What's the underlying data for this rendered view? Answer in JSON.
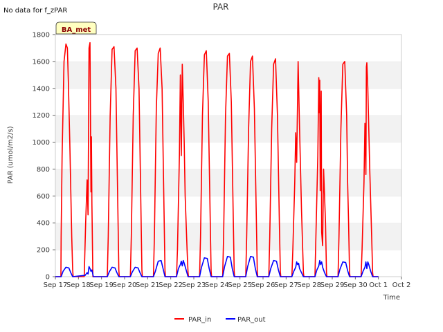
{
  "no_data_note": "No data for f_zPAR",
  "site_badge": "BA_met",
  "chart_data": {
    "type": "line",
    "title": "PAR",
    "xlabel": "Time",
    "ylabel": "PAR (umol/m2/s)",
    "xlim": [
      "2023-09-17",
      "2023-10-02"
    ],
    "ylim": [
      0,
      1800
    ],
    "x_ticks": [
      "Sep 17",
      "Sep 18",
      "Sep 19",
      "Sep 20",
      "Sep 21",
      "Sep 22",
      "Sep 23",
      "Sep 24",
      "Sep 25",
      "Sep 26",
      "Sep 27",
      "Sep 28",
      "Sep 29",
      "Sep 30",
      "Oct 1",
      "Oct 2"
    ],
    "y_ticks": [
      0,
      200,
      400,
      600,
      800,
      1000,
      1200,
      1400,
      1600,
      1800
    ],
    "grid": "horizontal bands",
    "legend_position": "bottom",
    "series": [
      {
        "name": "PAR_in",
        "color": "#ff0000",
        "x": [
          "2023-09-17 00:00",
          "2023-09-17 05:45",
          "2023-09-17 06:00",
          "2023-09-17 07:00",
          "2023-09-17 09:00",
          "2023-09-17 11:00",
          "2023-09-17 12:30",
          "2023-09-17 13:30",
          "2023-09-17 15:00",
          "2023-09-17 17:00",
          "2023-09-17 18:00",
          "2023-09-17 18:30",
          "2023-09-18 06:00",
          "2023-09-18 07:30",
          "2023-09-18 09:00",
          "2023-09-18 10:00",
          "2023-09-18 11:00",
          "2023-09-18 12:00",
          "2023-09-18 13:00",
          "2023-09-18 13:30",
          "2023-09-18 14:00",
          "2023-09-18 15:00",
          "2023-09-18 16:00",
          "2023-09-18 18:30",
          "2023-09-19 06:00",
          "2023-09-19 07:00",
          "2023-09-19 09:00",
          "2023-09-19 11:00",
          "2023-09-19 13:00",
          "2023-09-19 15:00",
          "2023-09-19 17:00",
          "2023-09-19 18:00",
          "2023-09-19 18:30",
          "2023-09-20 06:00",
          "2023-09-20 07:00",
          "2023-09-20 09:00",
          "2023-09-20 11:00",
          "2023-09-20 13:00",
          "2023-09-20 15:00",
          "2023-09-20 17:00",
          "2023-09-20 18:00",
          "2023-09-20 18:30",
          "2023-09-21 06:00",
          "2023-09-21 07:00",
          "2023-09-21 09:00",
          "2023-09-21 11:00",
          "2023-09-21 13:00",
          "2023-09-21 15:00",
          "2023-09-21 17:00",
          "2023-09-21 18:00",
          "2023-09-21 18:30",
          "2023-09-22 06:00",
          "2023-09-22 07:00",
          "2023-09-22 09:00",
          "2023-09-22 10:00",
          "2023-09-22 11:00",
          "2023-09-22 12:00",
          "2023-09-22 13:00",
          "2023-09-22 14:00",
          "2023-09-22 15:00",
          "2023-09-22 17:00",
          "2023-09-22 18:00",
          "2023-09-22 18:30",
          "2023-09-23 06:00",
          "2023-09-23 07:00",
          "2023-09-23 09:00",
          "2023-09-23 11:00",
          "2023-09-23 13:00",
          "2023-09-23 15:00",
          "2023-09-23 17:00",
          "2023-09-23 18:00",
          "2023-09-23 18:30",
          "2023-09-24 06:00",
          "2023-09-24 07:00",
          "2023-09-24 09:00",
          "2023-09-24 11:00",
          "2023-09-24 13:00",
          "2023-09-24 15:00",
          "2023-09-24 17:00",
          "2023-09-24 18:00",
          "2023-09-24 18:30",
          "2023-09-25 06:00",
          "2023-09-25 07:00",
          "2023-09-25 09:00",
          "2023-09-25 11:00",
          "2023-09-25 12:00",
          "2023-09-25 13:00",
          "2023-09-25 15:00",
          "2023-09-25 17:00",
          "2023-09-25 18:00",
          "2023-09-25 18:30",
          "2023-09-26 06:00",
          "2023-09-26 07:00",
          "2023-09-26 09:00",
          "2023-09-26 11:00",
          "2023-09-26 13:00",
          "2023-09-26 15:00",
          "2023-09-26 17:00",
          "2023-09-26 18:00",
          "2023-09-26 18:30",
          "2023-09-27 06:00",
          "2023-09-27 07:00",
          "2023-09-27 09:00",
          "2023-09-27 10:00",
          "2023-09-27 11:00",
          "2023-09-27 12:30",
          "2023-09-27 14:00",
          "2023-09-27 16:00",
          "2023-09-27 18:00",
          "2023-09-27 18:30",
          "2023-09-28 06:00",
          "2023-09-28 07:00",
          "2023-09-28 09:00",
          "2023-09-28 10:00",
          "2023-09-28 10:30",
          "2023-09-28 11:00",
          "2023-09-28 11:30",
          "2023-09-28 12:00",
          "2023-09-28 12:30",
          "2023-09-28 13:00",
          "2023-09-28 14:00",
          "2023-09-28 15:00",
          "2023-09-28 17:00",
          "2023-09-28 18:00",
          "2023-09-28 18:30",
          "2023-09-29 06:00",
          "2023-09-29 07:00",
          "2023-09-29 09:00",
          "2023-09-29 11:00",
          "2023-09-29 13:00",
          "2023-09-29 15:00",
          "2023-09-29 16:00",
          "2023-09-29 17:00",
          "2023-09-29 18:00",
          "2023-09-29 18:30",
          "2023-09-30 06:00",
          "2023-09-30 07:00",
          "2023-09-30 09:00",
          "2023-09-30 10:00",
          "2023-09-30 11:00",
          "2023-09-30 11:30",
          "2023-09-30 12:00",
          "2023-09-30 13:00",
          "2023-09-30 15:00",
          "2023-09-30 17:00",
          "2023-09-30 18:00",
          "2023-09-30 18:30",
          "2023-10-01 00:00"
        ],
        "y": [
          0,
          0,
          300,
          900,
          1600,
          1730,
          1700,
          1450,
          1000,
          300,
          50,
          0,
          0,
          400,
          720,
          460,
          1700,
          1740,
          630,
          1040,
          540,
          0,
          0,
          0,
          0,
          300,
          1200,
          1690,
          1710,
          1400,
          500,
          50,
          0,
          0,
          300,
          1200,
          1680,
          1700,
          1400,
          500,
          50,
          0,
          0,
          300,
          1250,
          1660,
          1700,
          1400,
          500,
          50,
          0,
          0,
          200,
          900,
          1500,
          900,
          1580,
          1300,
          1000,
          600,
          200,
          30,
          0,
          0,
          300,
          1200,
          1650,
          1680,
          1300,
          450,
          40,
          0,
          0,
          300,
          1200,
          1640,
          1660,
          1300,
          450,
          40,
          0,
          0,
          300,
          1100,
          1600,
          1620,
          1640,
          1250,
          450,
          40,
          0,
          0,
          300,
          1100,
          1580,
          1620,
          1200,
          400,
          40,
          0,
          0,
          200,
          700,
          1070,
          850,
          1600,
          1100,
          500,
          30,
          0,
          0,
          300,
          900,
          1480,
          1220,
          1460,
          640,
          1140,
          1380,
          330,
          230,
          800,
          400,
          30,
          0,
          0,
          300,
          1100,
          1580,
          1600,
          1200,
          700,
          400,
          30,
          0,
          0,
          200,
          700,
          1140,
          760,
          1560,
          1590,
          1400,
          800,
          300,
          30,
          0,
          0
        ]
      },
      {
        "name": "PAR_out",
        "color": "#0000ff",
        "x": [
          "2023-09-17 00:00",
          "2023-09-17 06:00",
          "2023-09-17 08:00",
          "2023-09-17 11:00",
          "2023-09-17 14:00",
          "2023-09-17 16:00",
          "2023-09-17 18:00",
          "2023-09-18 07:00",
          "2023-09-18 09:00",
          "2023-09-18 10:00",
          "2023-09-18 11:00",
          "2023-09-18 12:00",
          "2023-09-18 13:00",
          "2023-09-18 14:00",
          "2023-09-18 15:30",
          "2023-09-19 06:00",
          "2023-09-19 08:00",
          "2023-09-19 11:00",
          "2023-09-19 14:00",
          "2023-09-19 16:00",
          "2023-09-19 18:00",
          "2023-09-20 06:00",
          "2023-09-20 08:00",
          "2023-09-20 11:00",
          "2023-09-20 14:00",
          "2023-09-20 16:00",
          "2023-09-20 18:00",
          "2023-09-21 06:00",
          "2023-09-21 08:00",
          "2023-09-21 11:00",
          "2023-09-21 14:00",
          "2023-09-21 16:00",
          "2023-09-21 18:00",
          "2023-09-22 06:00",
          "2023-09-22 08:00",
          "2023-09-22 10:00",
          "2023-09-22 11:00",
          "2023-09-22 12:00",
          "2023-09-22 13:00",
          "2023-09-22 14:00",
          "2023-09-22 16:00",
          "2023-09-22 18:00",
          "2023-09-23 06:00",
          "2023-09-23 08:00",
          "2023-09-23 11:00",
          "2023-09-23 14:00",
          "2023-09-23 16:00",
          "2023-09-23 18:00",
          "2023-09-24 06:00",
          "2023-09-24 08:00",
          "2023-09-24 11:00",
          "2023-09-24 14:00",
          "2023-09-24 16:00",
          "2023-09-24 18:00",
          "2023-09-25 06:00",
          "2023-09-25 08:00",
          "2023-09-25 11:00",
          "2023-09-25 14:00",
          "2023-09-25 16:00",
          "2023-09-25 18:00",
          "2023-09-26 06:00",
          "2023-09-26 08:00",
          "2023-09-26 11:00",
          "2023-09-26 14:00",
          "2023-09-26 16:00",
          "2023-09-26 18:00",
          "2023-09-27 06:00",
          "2023-09-27 08:00",
          "2023-09-27 10:00",
          "2023-09-27 11:00",
          "2023-09-27 12:00",
          "2023-09-27 13:00",
          "2023-09-27 14:00",
          "2023-09-27 16:00",
          "2023-09-27 18:00",
          "2023-09-28 06:00",
          "2023-09-28 08:00",
          "2023-09-28 10:00",
          "2023-09-28 11:00",
          "2023-09-28 12:00",
          "2023-09-28 13:00",
          "2023-09-28 14:00",
          "2023-09-28 16:00",
          "2023-09-28 18:00",
          "2023-09-29 06:00",
          "2023-09-29 08:00",
          "2023-09-29 11:00",
          "2023-09-29 14:00",
          "2023-09-29 16:00",
          "2023-09-29 18:00",
          "2023-09-30 06:00",
          "2023-09-30 08:00",
          "2023-09-30 10:00",
          "2023-09-30 11:00",
          "2023-09-30 12:00",
          "2023-09-30 13:00",
          "2023-09-30 14:00",
          "2023-09-30 16:00",
          "2023-09-30 18:00",
          "2023-10-01 00:00"
        ],
        "y": [
          0,
          0,
          40,
          70,
          65,
          30,
          0,
          10,
          30,
          20,
          75,
          60,
          40,
          50,
          0,
          0,
          35,
          70,
          65,
          30,
          0,
          0,
          35,
          70,
          65,
          30,
          0,
          0,
          40,
          115,
          120,
          60,
          0,
          0,
          60,
          90,
          115,
          80,
          120,
          100,
          50,
          0,
          0,
          70,
          140,
          135,
          60,
          0,
          0,
          75,
          150,
          145,
          60,
          0,
          0,
          75,
          150,
          145,
          60,
          0,
          0,
          60,
          120,
          115,
          50,
          0,
          0,
          40,
          70,
          110,
          90,
          100,
          60,
          30,
          0,
          0,
          50,
          80,
          120,
          90,
          110,
          70,
          30,
          0,
          0,
          55,
          110,
          105,
          45,
          0,
          0,
          40,
          70,
          110,
          60,
          110,
          90,
          40,
          0,
          0
        ]
      }
    ]
  }
}
